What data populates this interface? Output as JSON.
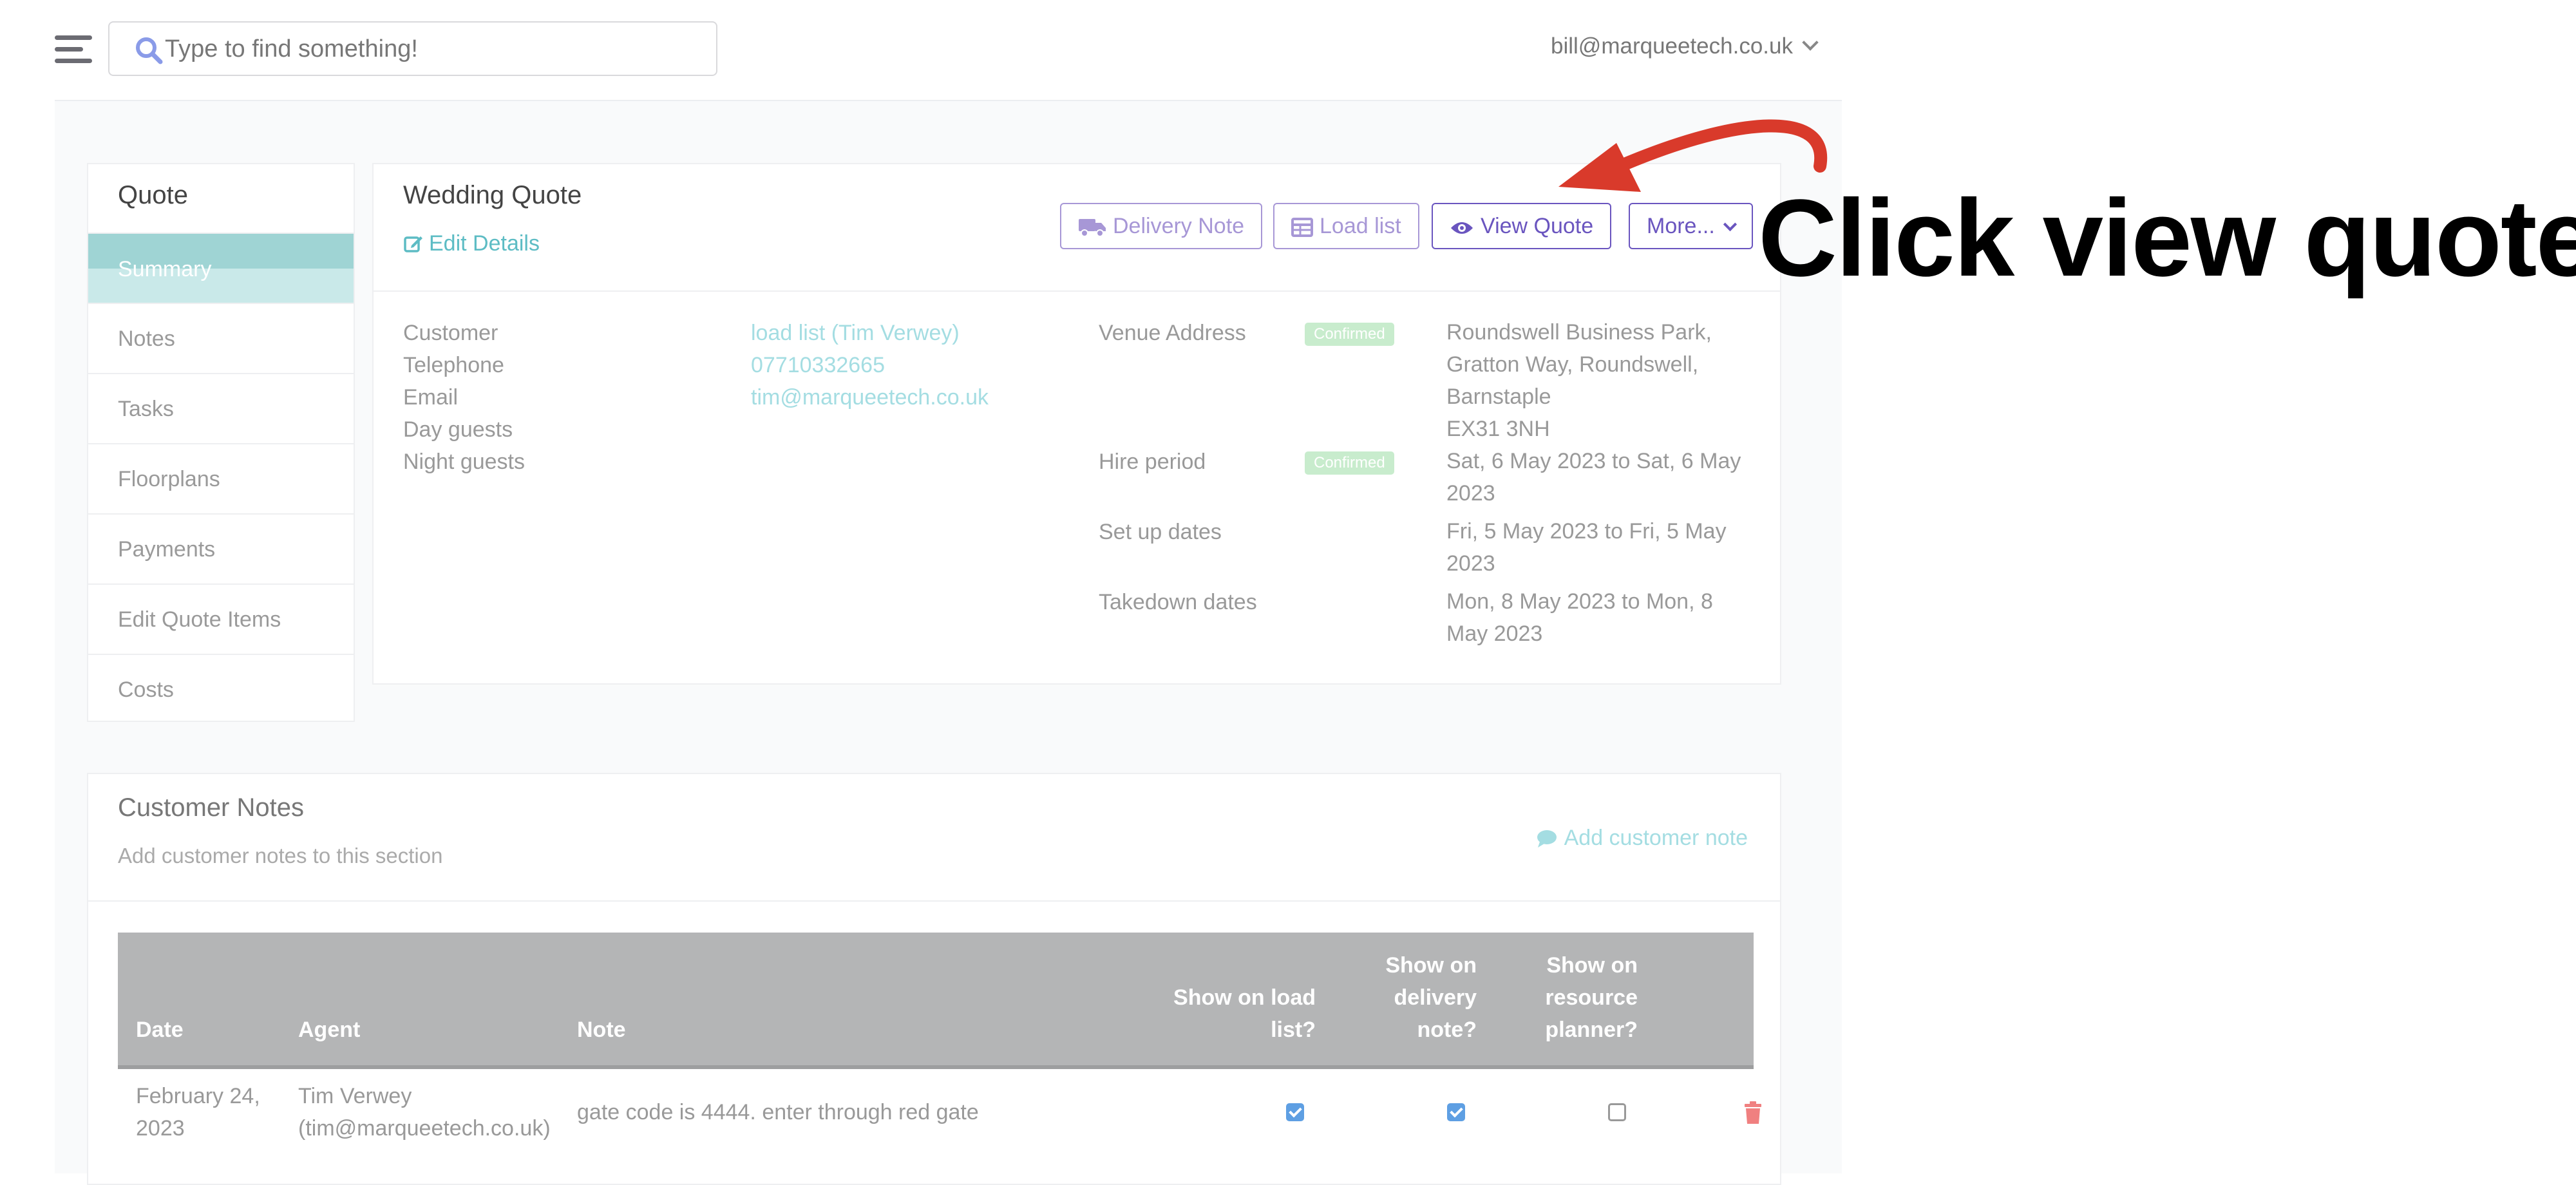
{
  "topbar": {
    "search_placeholder": "Type to find something!",
    "user_email": "bill@marqueetech.co.uk"
  },
  "sidenav": {
    "title": "Quote",
    "items": [
      "Summary",
      "Notes",
      "Tasks",
      "Floorplans",
      "Payments",
      "Edit Quote Items",
      "Costs"
    ],
    "active_index": 0
  },
  "quote": {
    "title": "Wedding Quote",
    "edit_label": "Edit Details",
    "buttons": {
      "delivery_note": "Delivery Note",
      "load_list": "Load list",
      "view_quote": "View Quote",
      "more": "More..."
    },
    "customer_label": "Customer",
    "customer_value": "load list (Tim Verwey)",
    "telephone_label": "Telephone",
    "telephone_value": "07710332665",
    "email_label": "Email",
    "email_value": "tim@marqueetech.co.uk",
    "day_guests_label": "Day guests",
    "night_guests_label": "Night guests",
    "venue_label": "Venue Address",
    "venue_badge": "Confirmed",
    "venue_value": "Roundswell Business Park, Gratton Way, Roundswell, Barnstaple",
    "venue_postcode": "EX31 3NH",
    "hire_label": "Hire period",
    "hire_badge": "Confirmed",
    "hire_value": "Sat, 6 May 2023 to Sat, 6 May 2023",
    "setup_label": "Set up dates",
    "setup_value": "Fri, 5 May 2023 to Fri, 5 May 2023",
    "takedown_label": "Takedown dates",
    "takedown_value": "Mon, 8 May 2023 to Mon, 8 May 2023"
  },
  "notes": {
    "title": "Customer Notes",
    "subtitle": "Add customer notes to this section",
    "add_label": "Add customer note",
    "columns": {
      "date": "Date",
      "agent": "Agent",
      "note": "Note",
      "load_list": "Show on load list?",
      "delivery_note": "Show on delivery note?",
      "resource_planner": "Show on resource planner?"
    },
    "rows": [
      {
        "date": "February 24, 2023",
        "agent_name": "Tim Verwey",
        "agent_email": "(tim@marqueetech.co.uk)",
        "note": "gate code is 4444. enter through red gate",
        "show_load_list": true,
        "show_delivery_note": true,
        "show_resource_planner": false
      }
    ]
  },
  "annotation": {
    "text": "Click view quote",
    "arrow_color": "#d93a2b"
  },
  "colors": {
    "accent_purple": "#6a55bf",
    "accent_teal": "#5dbcc4",
    "active_nav": "#9fd4d4",
    "badge_green": "#c8eccd",
    "table_header": "#b4b5b6",
    "checkbox_blue": "#5e9fe3",
    "delete_red": "#f08080"
  }
}
